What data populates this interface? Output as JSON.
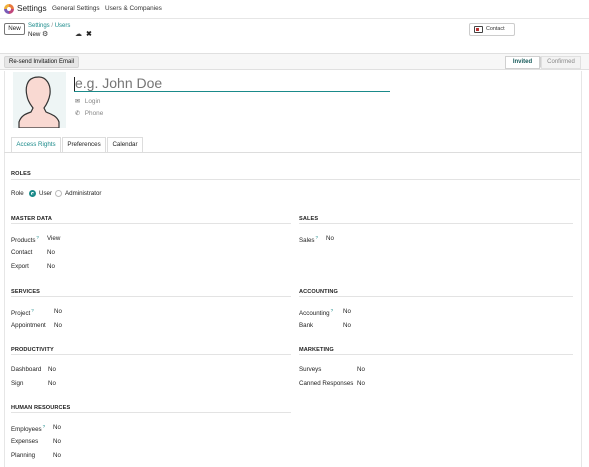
{
  "topbar": {
    "app_title": "Settings",
    "menu": [
      "General Settings",
      "Users & Companies"
    ]
  },
  "control": {
    "new_label": "New",
    "breadcrumb_parent": "Settings",
    "breadcrumb_current": "Users",
    "breadcrumb_sep": "/",
    "record_label": "New",
    "contact_label": "Contact"
  },
  "statusbar": {
    "resend_label": "Re-send Invitation Email",
    "stages": [
      "Invited",
      "Confirmed"
    ],
    "active_stage": "Invited"
  },
  "form": {
    "name_placeholder": "e.g. John Doe",
    "login_placeholder": "Login",
    "phone_placeholder": "Phone"
  },
  "tabs": [
    "Access Rights",
    "Preferences",
    "Calendar"
  ],
  "active_tab": "Access Rights",
  "roles": {
    "title": "ROLES",
    "label": "Role",
    "options": [
      "User",
      "Administrator"
    ],
    "selected": "User"
  },
  "sections": {
    "master_data": {
      "title": "MASTER DATA",
      "rows": [
        {
          "label": "Products",
          "value": "View",
          "help": "?"
        },
        {
          "label": "Contact",
          "value": "No",
          "help": ""
        },
        {
          "label": "Export",
          "value": "No",
          "help": ""
        }
      ]
    },
    "sales": {
      "title": "SALES",
      "rows": [
        {
          "label": "Sales",
          "value": "No",
          "help": "?"
        }
      ]
    },
    "services": {
      "title": "SERVICES",
      "rows": [
        {
          "label": "Project",
          "value": "No",
          "help": "?"
        },
        {
          "label": "Appointment",
          "value": "No",
          "help": ""
        }
      ]
    },
    "accounting": {
      "title": "ACCOUNTING",
      "rows": [
        {
          "label": "Accounting",
          "value": "No",
          "help": "?"
        },
        {
          "label": "Bank",
          "value": "No",
          "help": ""
        }
      ]
    },
    "productivity": {
      "title": "PRODUCTIVITY",
      "rows": [
        {
          "label": "Dashboard",
          "value": "No",
          "help": ""
        },
        {
          "label": "Sign",
          "value": "No",
          "help": ""
        }
      ]
    },
    "marketing": {
      "title": "MARKETING",
      "rows": [
        {
          "label": "Surveys",
          "value": "No",
          "help": ""
        },
        {
          "label": "Canned Responses",
          "value": "No",
          "help": ""
        }
      ]
    },
    "human_resources": {
      "title": "HUMAN RESOURCES",
      "rows": [
        {
          "label": "Employees",
          "value": "No",
          "help": "?"
        },
        {
          "label": "Expenses",
          "value": "No",
          "help": ""
        },
        {
          "label": "Planning",
          "value": "No",
          "help": ""
        }
      ]
    }
  },
  "icons": {
    "app": "settings-logo-icon",
    "record_gear": "gear-icon",
    "save": "cloud-upload-icon",
    "discard": "close-icon",
    "contact": "id-card-icon",
    "login": "envelope-icon",
    "phone": "phone-icon",
    "avatar": "user-silhouette-icon"
  },
  "colors": {
    "accent": "#1a8a8a",
    "avatar_fill": "#f9d9d2",
    "avatar_stroke": "#333333"
  }
}
